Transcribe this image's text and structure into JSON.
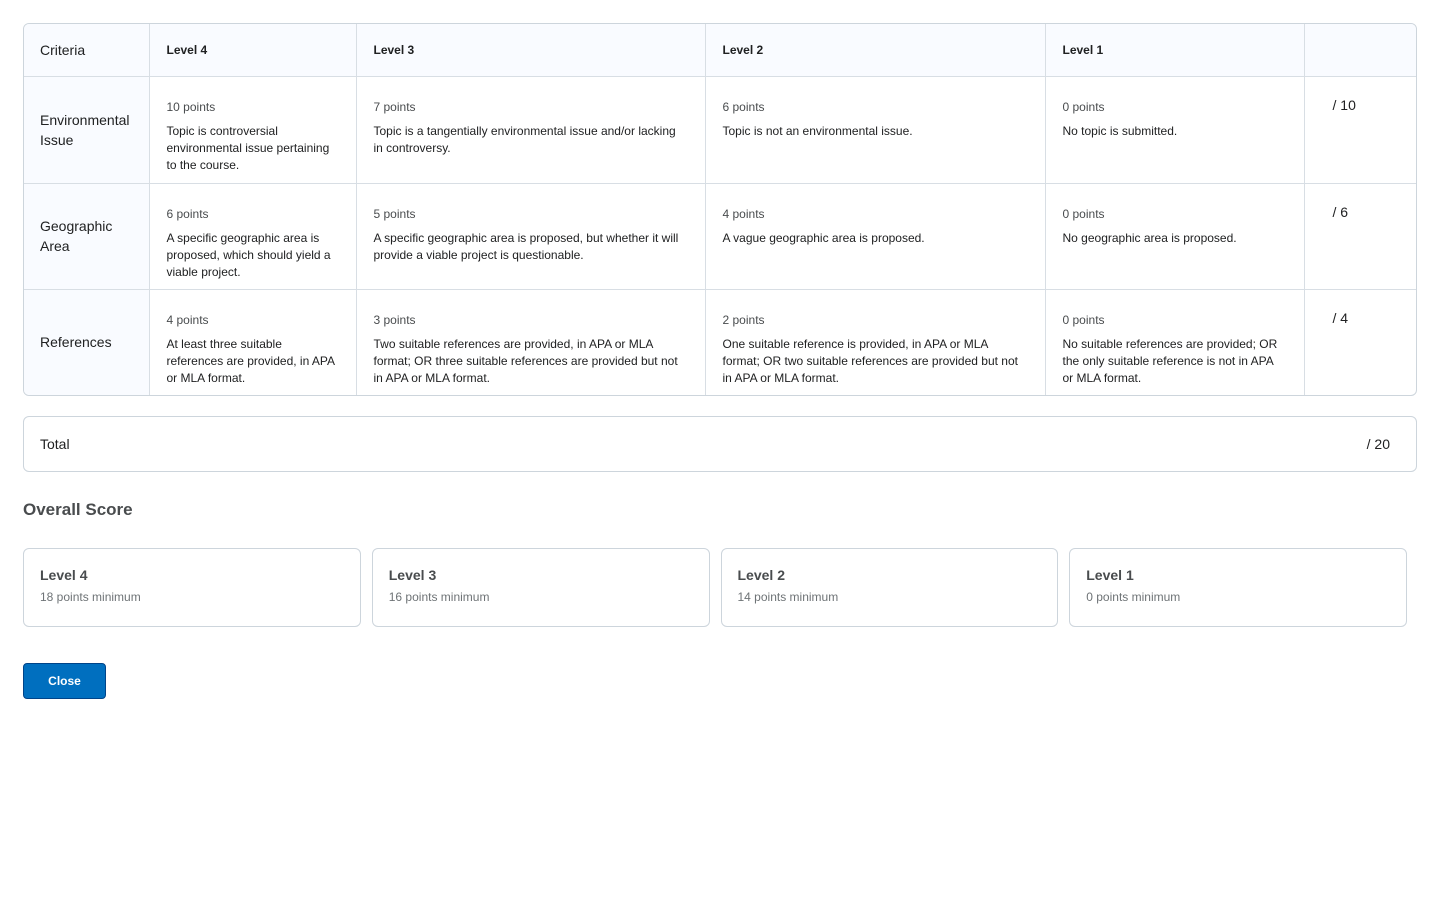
{
  "rubric": {
    "headers": {
      "criteria": "Criteria",
      "level4": "Level 4",
      "level3": "Level 3",
      "level2": "Level 2",
      "level1": "Level 1",
      "score": ""
    },
    "rows": [
      {
        "criterion": "Environmental Issue",
        "cells": [
          {
            "points": "10 points",
            "description": "Topic is controversial environmental issue pertaining to the course."
          },
          {
            "points": "7 points",
            "description": "Topic is a tangentially environmental issue and/or lacking in controversy."
          },
          {
            "points": "6 points",
            "description": "Topic is not an environmental issue."
          },
          {
            "points": "0 points",
            "description": "No topic is submitted."
          }
        ],
        "score": "/ 10"
      },
      {
        "criterion": "Geographic Area",
        "cells": [
          {
            "points": "6 points",
            "description": "A specific geographic area is proposed, which should yield a viable project."
          },
          {
            "points": "5 points",
            "description": "A specific geographic area is proposed, but whether it will provide a viable project is questionable."
          },
          {
            "points": "4 points",
            "description": "A vague geographic area is proposed."
          },
          {
            "points": "0 points",
            "description": "No geographic area is proposed."
          }
        ],
        "score": "/ 6"
      },
      {
        "criterion": "References",
        "cells": [
          {
            "points": "4 points",
            "description": "At least three suitable references are provided, in APA or MLA format."
          },
          {
            "points": "3 points",
            "description": "Two suitable references are provided, in APA or MLA format; OR three suitable references are provided but not in APA or MLA format."
          },
          {
            "points": "2 points",
            "description": "One suitable reference is provided, in APA or MLA format; OR two suitable references are provided but not in APA or MLA format."
          },
          {
            "points": "0 points",
            "description": "No suitable references are provided; OR the only suitable reference is not in APA or MLA format."
          }
        ],
        "score": "/ 4"
      }
    ]
  },
  "total": {
    "label": "Total",
    "value": "/ 20"
  },
  "overall": {
    "title": "Overall Score",
    "levels": [
      {
        "name": "Level 4",
        "minimum": "18 points minimum"
      },
      {
        "name": "Level 3",
        "minimum": "16 points minimum"
      },
      {
        "name": "Level 2",
        "minimum": "14 points minimum"
      },
      {
        "name": "Level 1",
        "minimum": "0 points minimum"
      }
    ]
  },
  "actions": {
    "close_label": "Close"
  }
}
